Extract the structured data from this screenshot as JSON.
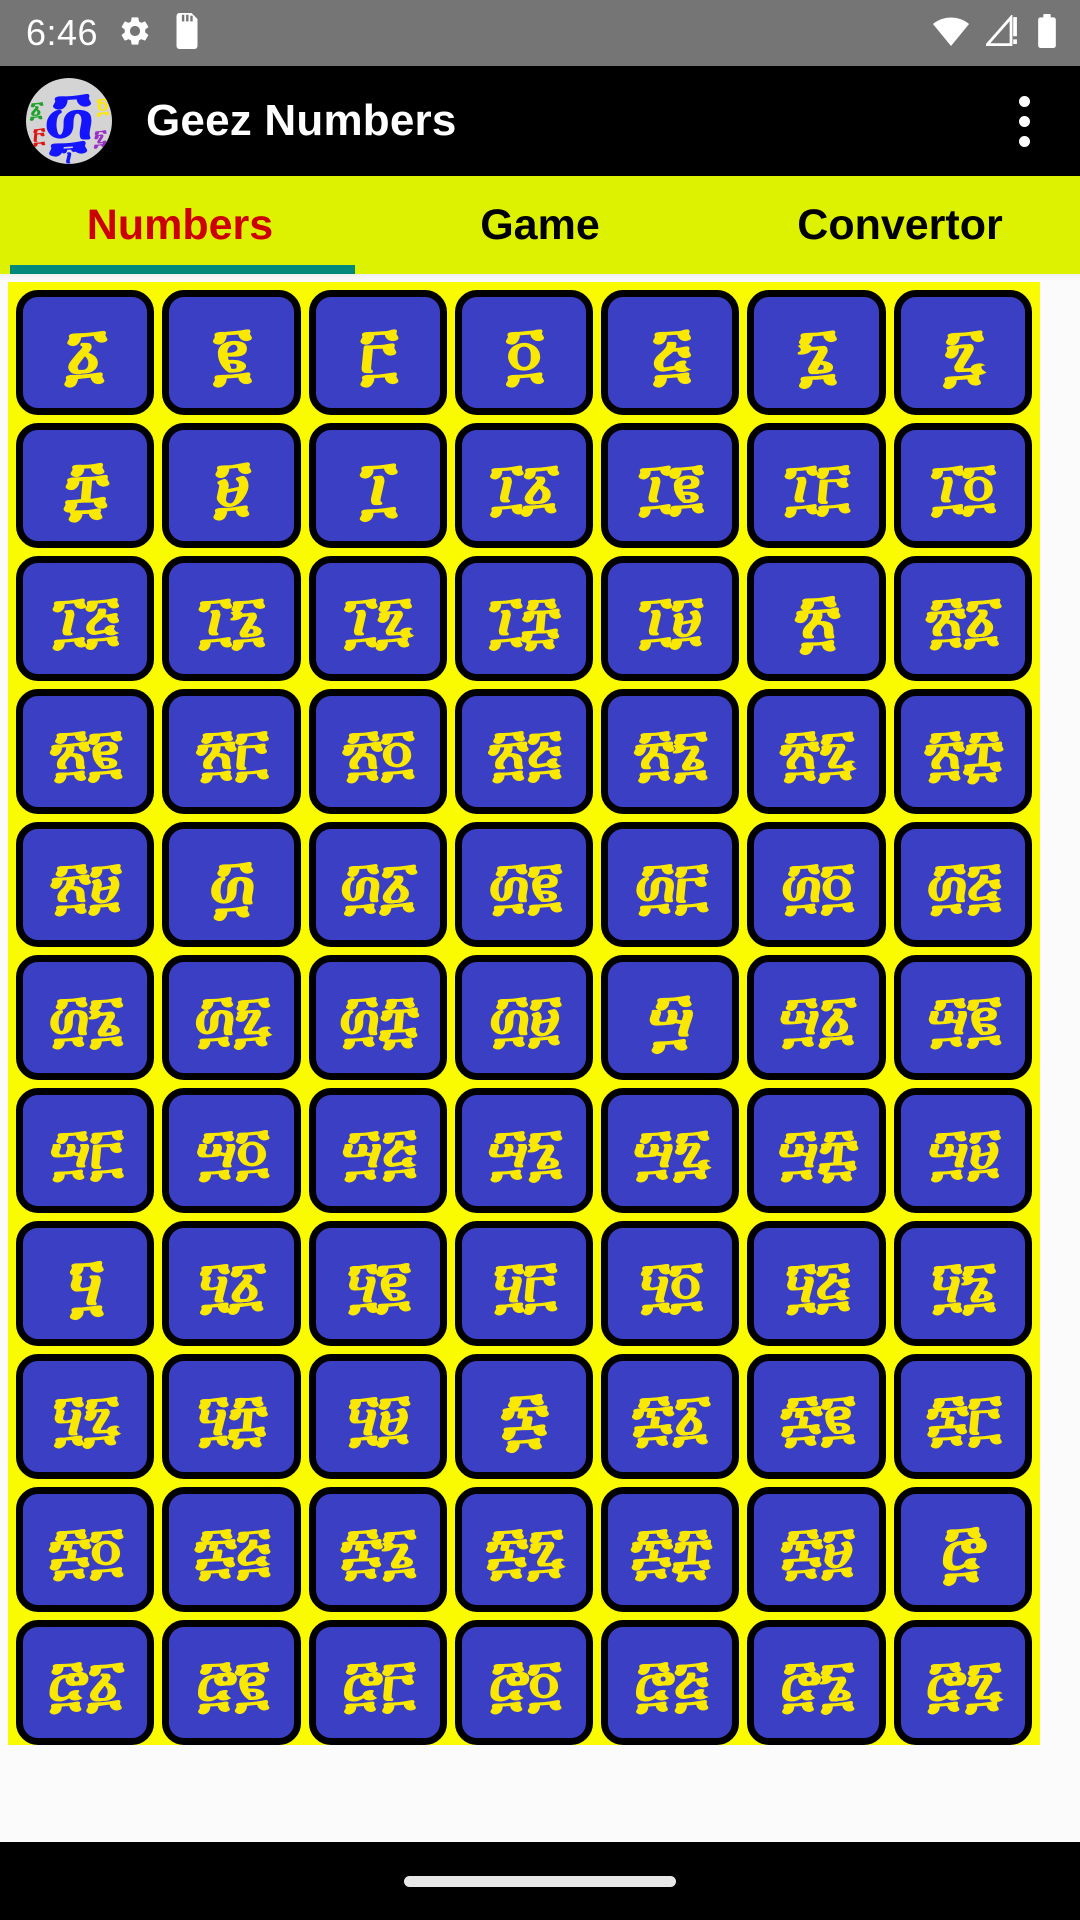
{
  "statusbar": {
    "time": "6:46",
    "icons_left": [
      "gear-icon",
      "sd-card-icon"
    ],
    "icons_right": [
      "wifi-icon",
      "cellular-signal-warning-icon",
      "battery-icon"
    ],
    "background_color": "#757575",
    "foreground_color": "#ffffff"
  },
  "appbar": {
    "title": "Geez Numbers",
    "logo_name": "geez-numbers-app-logo",
    "logo_glyph": "፴",
    "logo_accent_glyphs": [
      "፩",
      "፬",
      "፫",
      "፯",
      "፲"
    ],
    "overflow_menu": "more-options-icon",
    "background_color": "#000000",
    "title_color": "#ffffff"
  },
  "tabs": {
    "background_color": "#ddf200",
    "active_color": "#cc0000",
    "inactive_color": "#000000",
    "indicator_color": "#00897b",
    "active_index": 0,
    "items": [
      {
        "label": "Numbers"
      },
      {
        "label": "Game"
      },
      {
        "label": "Convertor"
      }
    ]
  },
  "grid": {
    "background_color": "#fbfb00",
    "tile_color": "#3a3fc4",
    "tile_border_color": "#000000",
    "glyph_color": "#fbe800",
    "columns": 7,
    "rows": [
      {
        "cells": [
          {
            "glyph": "፩",
            "value": "1"
          },
          {
            "glyph": "፪",
            "value": "2"
          },
          {
            "glyph": "፫",
            "value": "3"
          },
          {
            "glyph": "፬",
            "value": "4"
          },
          {
            "glyph": "፭",
            "value": "5"
          },
          {
            "glyph": "፮",
            "value": "6"
          },
          {
            "glyph": "፯",
            "value": "7"
          }
        ]
      },
      {
        "cells": [
          {
            "glyph": "፰",
            "value": "8"
          },
          {
            "glyph": "፱",
            "value": "9"
          },
          {
            "glyph": "፲",
            "value": "10"
          },
          {
            "glyph": "፲፩",
            "value": "11"
          },
          {
            "glyph": "፲፪",
            "value": "12"
          },
          {
            "glyph": "፲፫",
            "value": "13"
          },
          {
            "glyph": "፲፬",
            "value": "14"
          }
        ]
      },
      {
        "cells": [
          {
            "glyph": "፲፭",
            "value": "15"
          },
          {
            "glyph": "፲፮",
            "value": "16"
          },
          {
            "glyph": "፲፯",
            "value": "17"
          },
          {
            "glyph": "፲፰",
            "value": "18"
          },
          {
            "glyph": "፲፱",
            "value": "19"
          },
          {
            "glyph": "፳",
            "value": "20"
          },
          {
            "glyph": "፳፩",
            "value": "21"
          }
        ]
      },
      {
        "cells": [
          {
            "glyph": "፳፪",
            "value": "22"
          },
          {
            "glyph": "፳፫",
            "value": "23"
          },
          {
            "glyph": "፳፬",
            "value": "24"
          },
          {
            "glyph": "፳፭",
            "value": "25"
          },
          {
            "glyph": "፳፮",
            "value": "26"
          },
          {
            "glyph": "፳፯",
            "value": "27"
          },
          {
            "glyph": "፳፰",
            "value": "28"
          }
        ]
      },
      {
        "cells": [
          {
            "glyph": "፳፱",
            "value": "29"
          },
          {
            "glyph": "፴",
            "value": "30"
          },
          {
            "glyph": "፴፩",
            "value": "31"
          },
          {
            "glyph": "፴፪",
            "value": "32"
          },
          {
            "glyph": "፴፫",
            "value": "33"
          },
          {
            "glyph": "፴፬",
            "value": "34"
          },
          {
            "glyph": "፴፭",
            "value": "35"
          }
        ]
      },
      {
        "cells": [
          {
            "glyph": "፴፮",
            "value": "36"
          },
          {
            "glyph": "፴፯",
            "value": "37"
          },
          {
            "glyph": "፴፰",
            "value": "38"
          },
          {
            "glyph": "፴፱",
            "value": "39"
          },
          {
            "glyph": "፵",
            "value": "40"
          },
          {
            "glyph": "፵፩",
            "value": "41"
          },
          {
            "glyph": "፵፪",
            "value": "42"
          }
        ]
      },
      {
        "cells": [
          {
            "glyph": "፵፫",
            "value": "43"
          },
          {
            "glyph": "፵፬",
            "value": "44"
          },
          {
            "glyph": "፵፭",
            "value": "45"
          },
          {
            "glyph": "፵፮",
            "value": "46"
          },
          {
            "glyph": "፵፯",
            "value": "47"
          },
          {
            "glyph": "፵፰",
            "value": "48"
          },
          {
            "glyph": "፵፱",
            "value": "49"
          }
        ]
      },
      {
        "cells": [
          {
            "glyph": "፶",
            "value": "50"
          },
          {
            "glyph": "፶፩",
            "value": "51"
          },
          {
            "glyph": "፶፪",
            "value": "52"
          },
          {
            "glyph": "፶፫",
            "value": "53"
          },
          {
            "glyph": "፶፬",
            "value": "54"
          },
          {
            "glyph": "፶፭",
            "value": "55"
          },
          {
            "glyph": "፶፮",
            "value": "56"
          }
        ]
      },
      {
        "cells": [
          {
            "glyph": "፶፯",
            "value": "57"
          },
          {
            "glyph": "፶፰",
            "value": "58"
          },
          {
            "glyph": "፶፱",
            "value": "59"
          },
          {
            "glyph": "፷",
            "value": "60"
          },
          {
            "glyph": "፷፩",
            "value": "61"
          },
          {
            "glyph": "፷፪",
            "value": "62"
          },
          {
            "glyph": "፷፫",
            "value": "63"
          }
        ]
      },
      {
        "cells": [
          {
            "glyph": "፷፬",
            "value": "64"
          },
          {
            "glyph": "፷፭",
            "value": "65"
          },
          {
            "glyph": "፷፮",
            "value": "66"
          },
          {
            "glyph": "፷፯",
            "value": "67"
          },
          {
            "glyph": "፷፰",
            "value": "68"
          },
          {
            "glyph": "፷፱",
            "value": "69"
          },
          {
            "glyph": "፸",
            "value": "70"
          }
        ]
      },
      {
        "cells": [
          {
            "glyph": "፸፩",
            "value": "71"
          },
          {
            "glyph": "፸፪",
            "value": "72"
          },
          {
            "glyph": "፸፫",
            "value": "73"
          },
          {
            "glyph": "፸፬",
            "value": "74"
          },
          {
            "glyph": "፸፭",
            "value": "75"
          },
          {
            "glyph": "፸፮",
            "value": "76"
          },
          {
            "glyph": "፸፯",
            "value": "77"
          }
        ]
      }
    ]
  },
  "navbar": {
    "home_indicator": "home-indicator",
    "background_color": "#000000"
  }
}
